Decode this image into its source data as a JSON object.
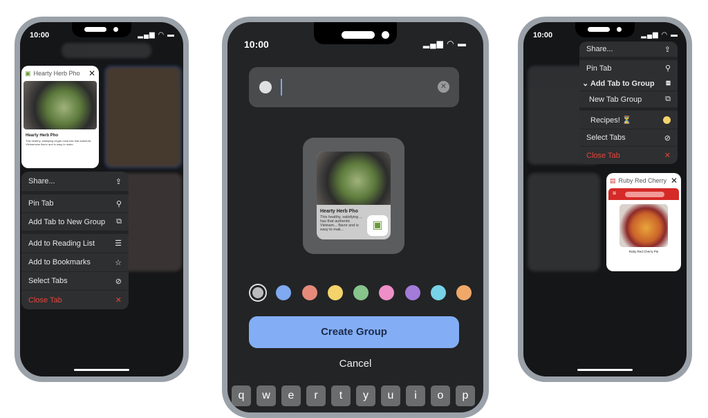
{
  "status": {
    "time": "10:00",
    "signal": "signal-icon",
    "wifi": "wifi-icon",
    "battery": "battery-icon"
  },
  "left": {
    "tab_title": "Hearty Herb Pho",
    "tab_heading": "Hearty Herb Pho",
    "tab_body": "This healthy, satisfying vegan meal has that authentic Vietnamese flavor and is easy to make.",
    "menu": [
      {
        "label": "Share...",
        "icon": "share-icon"
      },
      {
        "label": "Pin Tab",
        "icon": "pin-icon"
      },
      {
        "label": "Add Tab to New Group",
        "icon": "new-group-icon"
      },
      {
        "label": "Add to Reading List",
        "icon": "reading-list-icon"
      },
      {
        "label": "Add to Bookmarks",
        "icon": "star-icon"
      },
      {
        "label": "Select Tabs",
        "icon": "checkmark-circle-icon"
      },
      {
        "label": "Close Tab",
        "icon": "close-icon"
      }
    ]
  },
  "middle": {
    "input_value": "",
    "preview_title": "Hearty Herb Pho",
    "preview_body": "This healthy, satisfying ... has that authentic Vietnam... flavor and is easy to mak...",
    "colors": [
      "#e0e0e0",
      "#7fa9f0",
      "#e58a7a",
      "#f3d36a",
      "#86c48c",
      "#ee8fc8",
      "#a37bd9",
      "#78d3e6",
      "#f0a868"
    ],
    "selected_color": 0,
    "create_label": "Create Group",
    "cancel_label": "Cancel",
    "keys": [
      "q",
      "w",
      "e",
      "r",
      "t",
      "y",
      "u",
      "i",
      "o",
      "p"
    ]
  },
  "right": {
    "menu": [
      {
        "label": "Share...",
        "icon": "share-icon"
      },
      {
        "label": "Pin Tab",
        "icon": "pin-icon"
      },
      {
        "label": "Add Tab to Group",
        "icon": "open-group-icon"
      },
      {
        "label": "New Tab Group",
        "icon": "new-group-icon"
      },
      {
        "label": "Recipes! ⏳",
        "icon": "yellow-dot"
      },
      {
        "label": "Select Tabs",
        "icon": "checkmark-circle-icon"
      },
      {
        "label": "Close Tab",
        "icon": "close-icon"
      }
    ],
    "tab_title": "Ruby Red Cherry",
    "tab_caption": "Ruby Red Cherry Pie"
  }
}
